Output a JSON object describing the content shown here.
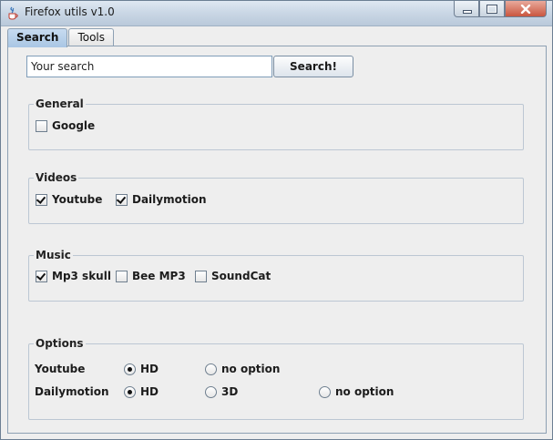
{
  "window": {
    "title": "Firefox utils v1.0"
  },
  "tabs": [
    {
      "label": "Search",
      "active": true
    },
    {
      "label": "Tools",
      "active": false
    }
  ],
  "search": {
    "value": "Your search",
    "button_label": "Search!"
  },
  "general": {
    "title": "General",
    "items": [
      {
        "label": "Google",
        "checked": false
      }
    ]
  },
  "videos": {
    "title": "Videos",
    "items": [
      {
        "label": "Youtube",
        "checked": true
      },
      {
        "label": "Dailymotion",
        "checked": true
      }
    ]
  },
  "music": {
    "title": "Music",
    "items": [
      {
        "label": "Mp3 skull",
        "checked": true
      },
      {
        "label": "Bee MP3",
        "checked": false
      },
      {
        "label": "SoundCat",
        "checked": false
      }
    ]
  },
  "options": {
    "title": "Options",
    "rows": [
      {
        "label": "Youtube",
        "choices": [
          {
            "label": "HD",
            "selected": true
          },
          {
            "label": "no option",
            "selected": false
          }
        ]
      },
      {
        "label": "Dailymotion",
        "choices": [
          {
            "label": "HD",
            "selected": true
          },
          {
            "label": "3D",
            "selected": false
          },
          {
            "label": "no option",
            "selected": false
          }
        ]
      }
    ]
  }
}
